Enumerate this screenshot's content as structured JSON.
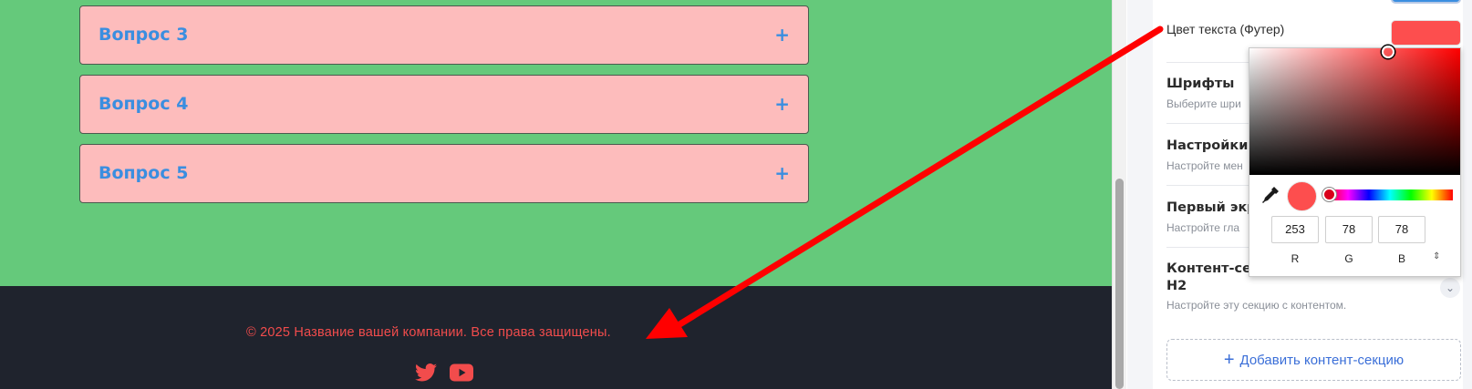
{
  "preview": {
    "faq": [
      {
        "question": "Вопрос 3",
        "icon": "+"
      },
      {
        "question": "Вопрос 4",
        "icon": "+"
      },
      {
        "question": "Вопрос 5",
        "icon": "+"
      }
    ],
    "footer": {
      "copyright": "© 2025 Название вашей компании. Все права защищены.",
      "text_color": "#fd4e4e",
      "background": "#1f232d",
      "social_icons": [
        "twitter-icon",
        "youtube-icon"
      ]
    },
    "content_background": "#65c97b",
    "faq_background": "#fdbcbc",
    "faq_text_color": "#3a8ee0"
  },
  "panel": {
    "footer_text_color_label": "Цвет текста (Футер)",
    "footer_text_color_value": "#fd4e4e",
    "sections": [
      {
        "title": "Шрифты",
        "description": "Выберите шри"
      },
      {
        "title": "Настройки м",
        "description": "Настройте мен"
      },
      {
        "title": "Первый экр",
        "description": "Настройте гла"
      },
      {
        "title": "Контент-сек",
        "title_line2": "H2",
        "description": "Настройте эту секцию с контентом."
      }
    ],
    "add_button": {
      "icon": "+",
      "label": "Добавить контент-секцию"
    }
  },
  "color_picker": {
    "r": "253",
    "g": "78",
    "b": "78",
    "r_label": "R",
    "g_label": "G",
    "b_label": "B",
    "mode_toggle": "⇕"
  }
}
